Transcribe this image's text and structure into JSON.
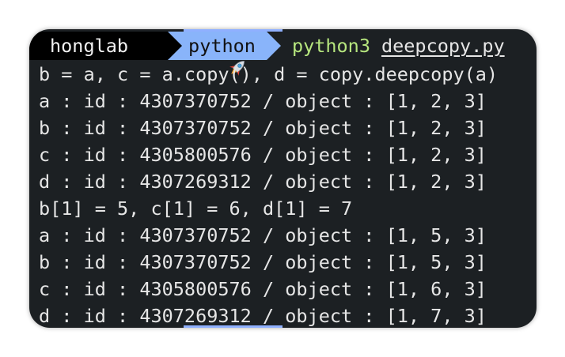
{
  "prompt": {
    "user": "honglab",
    "user_icon": "rocket-icon",
    "directory": "python",
    "command": "python3",
    "argument": "deepcopy.py"
  },
  "output_lines": [
    "b = a, c = a.copy(), d = copy.deepcopy(a)",
    "a : id : 4307370752 / object : [1, 2, 3]",
    "b : id : 4307370752 / object : [1, 2, 3]",
    "c : id : 4305800576 / object : [1, 2, 3]",
    "d : id : 4307269312 / object : [1, 2, 3]",
    "b[1] = 5, c[1] = 6, d[1] = 7",
    "a : id : 4307370752 / object : [1, 5, 3]",
    "b : id : 4307370752 / object : [1, 5, 3]",
    "c : id : 4305800576 / object : [1, 6, 3]",
    "d : id : 4307269312 / object : [1, 7, 3]"
  ],
  "colors": {
    "terminal_bg": "#1c2023",
    "segment_dir": "#89b4fa",
    "command": "#b6e67e",
    "text": "#e6e6e6"
  }
}
